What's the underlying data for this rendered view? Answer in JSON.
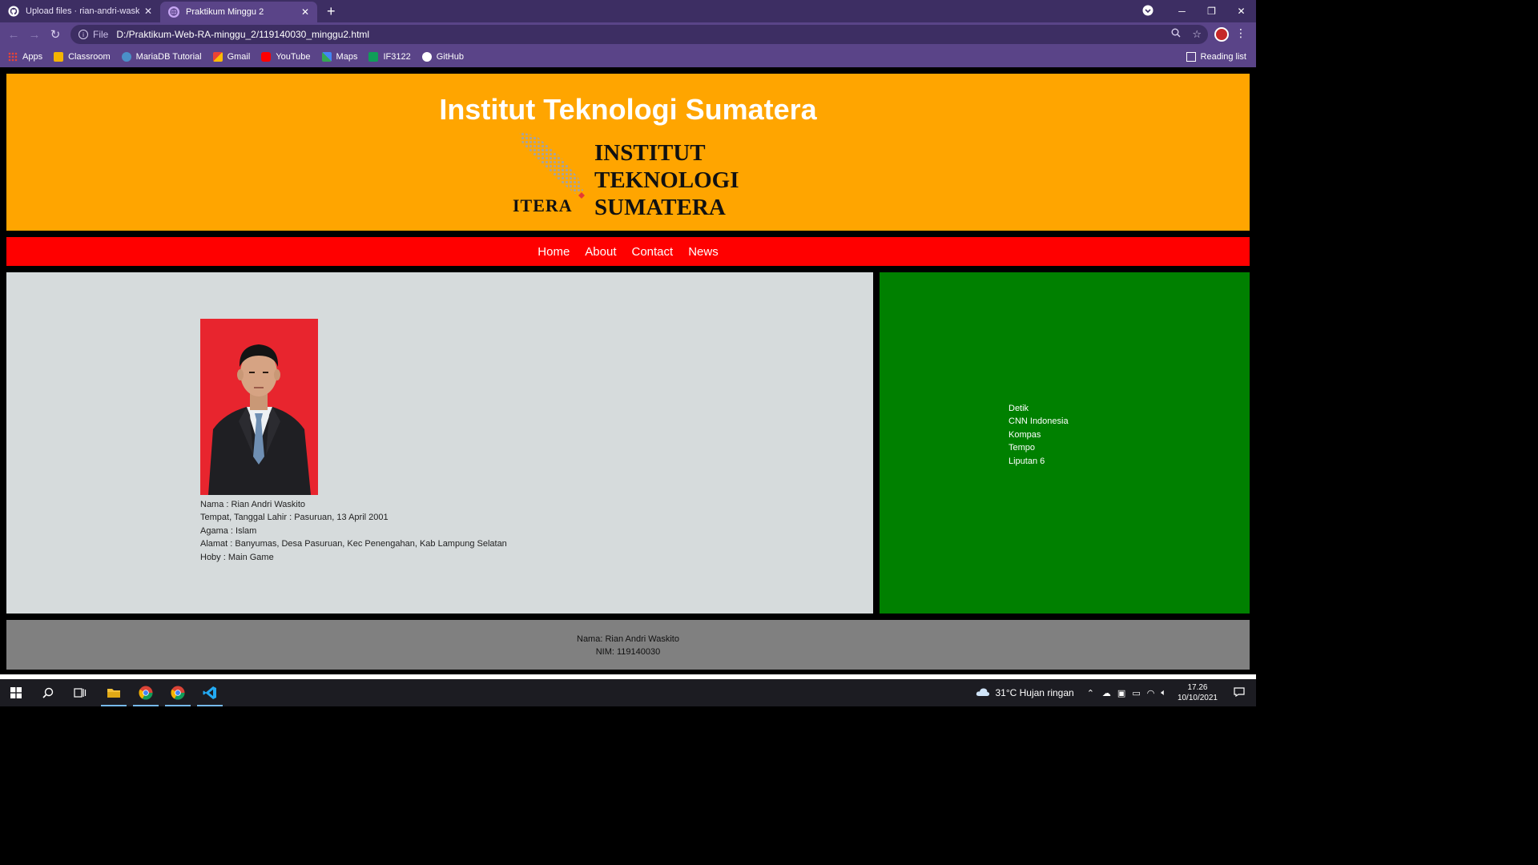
{
  "browser": {
    "tabs": [
      {
        "title": "Upload files · rian-andri-waskito",
        "icon": "github-icon",
        "active": false
      },
      {
        "title": "Praktikum Minggu 2",
        "icon": "globe-icon",
        "active": true
      }
    ],
    "address": {
      "scheme": "File",
      "url": "D:/Praktikum-Web-RA-minggu_2/119140030_minggu2.html"
    },
    "bookmarks": [
      {
        "label": "Apps",
        "icon": "apps-grid-icon",
        "color": "#4285f4"
      },
      {
        "label": "Classroom",
        "icon": "classroom-icon",
        "color": "#f4b400"
      },
      {
        "label": "MariaDB Tutorial",
        "icon": "mariadb-icon",
        "color": "#4a90c8"
      },
      {
        "label": "Gmail",
        "icon": "gmail-icon",
        "color": "#ea4335"
      },
      {
        "label": "YouTube",
        "icon": "youtube-icon",
        "color": "#ff0000"
      },
      {
        "label": "Maps",
        "icon": "maps-icon",
        "color": "#34a853"
      },
      {
        "label": "IF3122",
        "icon": "sheet-icon",
        "color": "#0f9d58"
      },
      {
        "label": "GitHub",
        "icon": "github-icon",
        "color": "#ffffff"
      }
    ],
    "reading_list": "Reading list"
  },
  "page": {
    "title": "Institut Teknologi Sumatera",
    "logo": {
      "line1": "INSTITUT",
      "line2": "TEKNOLOGI",
      "line3": "SUMATERA",
      "itera": "ITERA"
    },
    "nav": [
      "Home",
      "About",
      "Contact",
      "News"
    ],
    "bio": {
      "nama": "Nama : Rian Andri Waskito",
      "ttl": "Tempat, Tanggal Lahir : Pasuruan, 13 April 2001",
      "agama": "Agama : Islam",
      "alamat": "Alamat : Banyumas, Desa Pasuruan, Kec Penengahan, Kab Lampung Selatan",
      "hoby": "Hoby : Main Game"
    },
    "news_links": [
      "Detik",
      "CNN Indonesia",
      "Kompas",
      "Tempo",
      "Liputan 6"
    ],
    "footer": {
      "nama": "Nama: Rian Andri Waskito",
      "nim": "NIM: 119140030"
    },
    "colors": {
      "header": "#ffa500",
      "nav": "#ff0000",
      "main": "#d6dbdc",
      "side": "#008000",
      "footer": "#808080"
    }
  },
  "taskbar": {
    "weather": "31°C  Hujan ringan",
    "time": "17.26",
    "date": "10/10/2021"
  }
}
